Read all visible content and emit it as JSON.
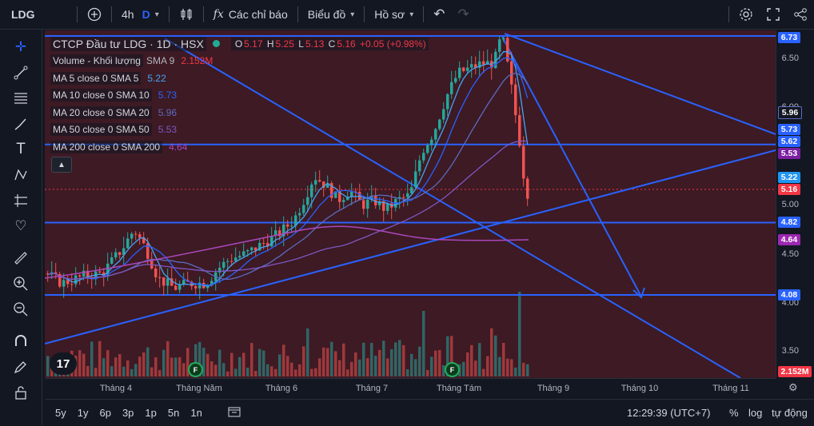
{
  "header": {
    "symbol": "LDG",
    "interval": "4h",
    "timeframe": "D",
    "indicators_label": "Các chỉ báo",
    "chart_type_label": "Biểu đồ",
    "profile_label": "Hồ sơ",
    "plus_icon": "plus-circle-icon",
    "fx_icon": "fx",
    "undo_icon": "↶",
    "redo_icon": "↷"
  },
  "legend": {
    "title": "CTCP Đầu tư LDG · 1D · HSX",
    "open_label": "O",
    "open": "5.17",
    "high_label": "H",
    "high": "5.25",
    "low_label": "L",
    "low": "5.13",
    "close_label": "C",
    "close": "5.16",
    "change": "+0.05 (+0.98%)",
    "volume_label": "Volume - Khối lượng",
    "volume_param": "SMA 9",
    "volume_value": "2.152M",
    "ma": [
      {
        "label": "MA 5 close 0 SMA 5",
        "value": "5.22",
        "color": "#42a5f5"
      },
      {
        "label": "MA 10 close 0 SMA 10",
        "value": "5.73",
        "color": "#2962ff"
      },
      {
        "label": "MA 20 close 0 SMA 20",
        "value": "5.96",
        "color": "#5c6bc0"
      },
      {
        "label": "MA 50 close 0 SMA 50",
        "value": "5.53",
        "color": "#7e57c2"
      },
      {
        "label": "MA 200 close 0 SMA 200",
        "value": "4.64",
        "color": "#ab47bc"
      }
    ]
  },
  "price_scale": {
    "ticks": [
      "6.50",
      "6.00",
      "5.50",
      "5.00",
      "4.50",
      "4.00",
      "3.50"
    ],
    "labels": [
      {
        "text": "6.73",
        "color": "#2962ff"
      },
      {
        "text": "5.96",
        "color": "#131722"
      },
      {
        "text": "5.73",
        "color": "#2962ff"
      },
      {
        "text": "5.62",
        "color": "#2962ff"
      },
      {
        "text": "5.53",
        "color": "#7b1fa2"
      },
      {
        "text": "5.22",
        "color": "#2196f3"
      },
      {
        "text": "5.16",
        "color": "#f23645"
      },
      {
        "text": "4.82",
        "color": "#2962ff"
      },
      {
        "text": "4.64",
        "color": "#9c27b0"
      },
      {
        "text": "4.08",
        "color": "#2962ff"
      },
      {
        "text": "2.152M",
        "color": "#f23645"
      }
    ]
  },
  "time_axis": [
    "Tháng 4",
    "Tháng Năm",
    "Tháng 6",
    "Tháng 7",
    "Tháng Tám",
    "Tháng 9",
    "Tháng 10",
    "Tháng 11"
  ],
  "bottom": {
    "ranges": [
      "5y",
      "1y",
      "6p",
      "3p",
      "1p",
      "5n",
      "1n"
    ],
    "time": "12:29:39 (UTC+7)",
    "percent": "%",
    "log": "log",
    "auto": "tự động"
  },
  "badges": {
    "earnings": "F",
    "logo": "17"
  },
  "colors": {
    "up": "#26a69a",
    "down": "#ef5350",
    "drawing": "#2962ff",
    "background": "#3d1a24"
  }
}
